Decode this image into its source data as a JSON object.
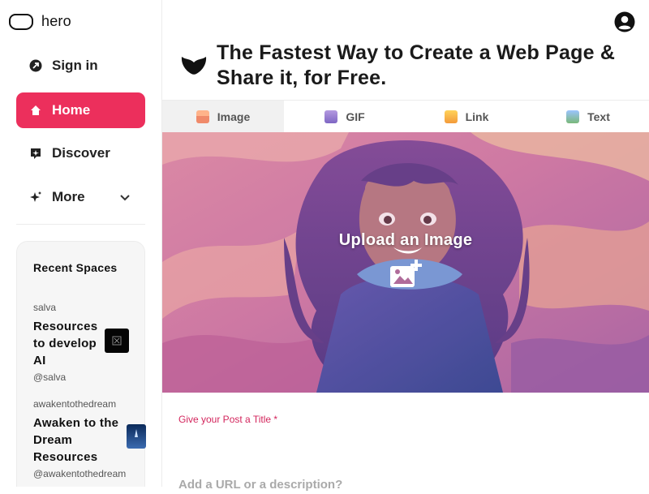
{
  "brand": {
    "name": "hero"
  },
  "nav": {
    "items": [
      {
        "label": "Sign in"
      },
      {
        "label": "Home",
        "active": true
      },
      {
        "label": "Discover"
      },
      {
        "label": "More"
      }
    ]
  },
  "recent_spaces": {
    "title": "Recent Spaces",
    "items": [
      {
        "owner": "salva",
        "title": "Resources to develop AI",
        "handle": "@salva"
      },
      {
        "owner": "awakentothedream",
        "title": "Awaken to the Dream Resources",
        "handle": "@awakentothedream"
      }
    ]
  },
  "header": {
    "headline": "The Fastest Way to Create a Web Page & Share it, for Free."
  },
  "tabs": [
    {
      "label": "Image",
      "icon": "image-emoji-icon",
      "active": true
    },
    {
      "label": "GIF",
      "icon": "gif-emoji-icon"
    },
    {
      "label": "Link",
      "icon": "link-emoji-icon"
    },
    {
      "label": "Text",
      "icon": "text-emoji-icon"
    }
  ],
  "upload": {
    "label": "Upload an Image",
    "icon": "add-image-icon"
  },
  "form": {
    "title_label": "Give your Post a Title *",
    "title_value": "",
    "description_placeholder": "Add a URL or a description?"
  },
  "colors": {
    "accent": "#ec2f5c",
    "label": "#d3255c"
  }
}
